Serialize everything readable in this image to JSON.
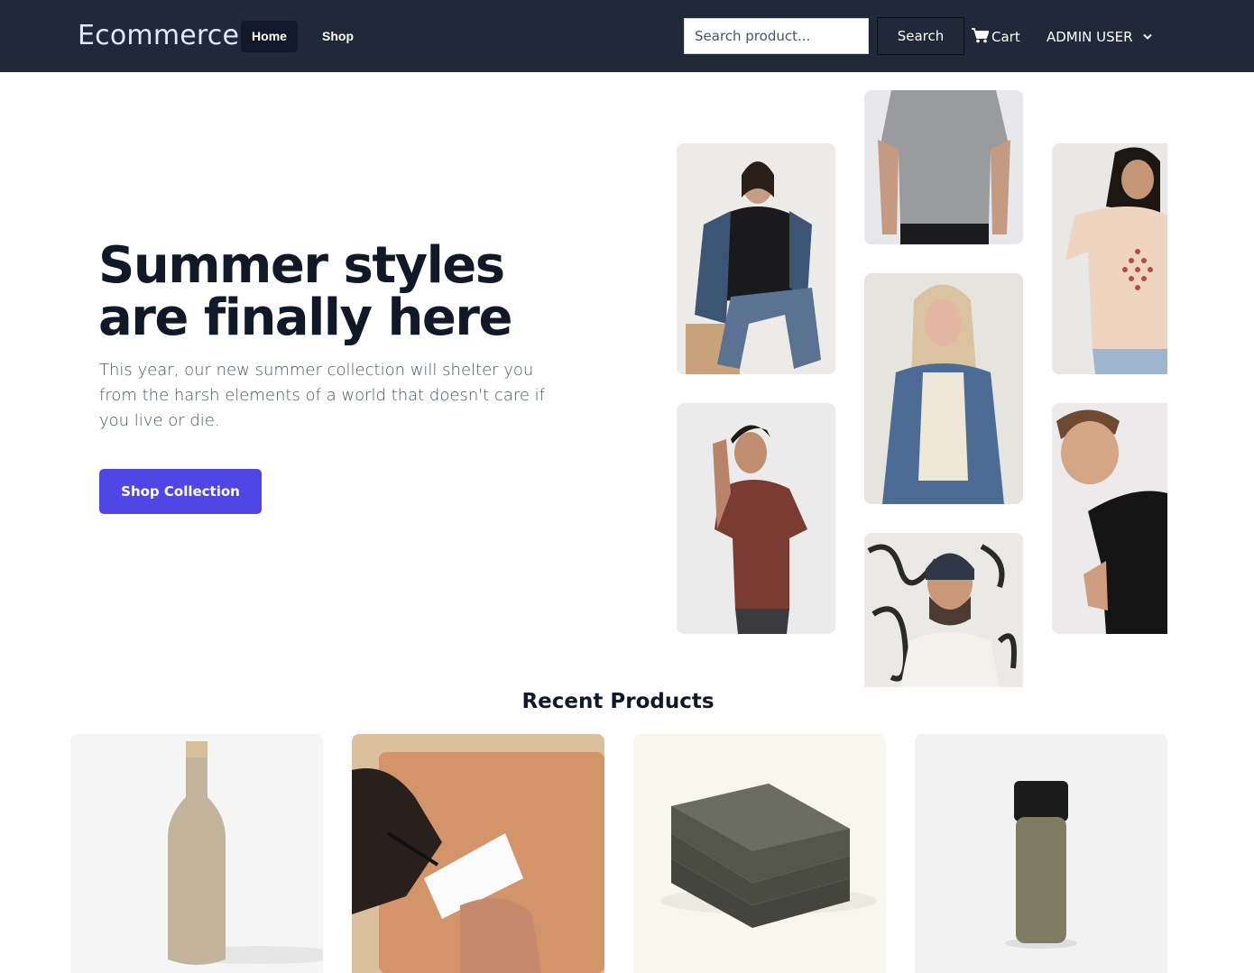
{
  "navbar": {
    "brand": "Ecommerce",
    "links": [
      {
        "label": "Home",
        "active": true
      },
      {
        "label": "Shop",
        "active": false
      }
    ],
    "search": {
      "placeholder": "Search product...",
      "value": "",
      "button_label": "Search"
    },
    "cart_label": "Cart",
    "cart_icon": "shopping-cart-icon",
    "user_label": "ADMIN USER",
    "user_icon": "chevron-down-icon"
  },
  "hero": {
    "title_line1": "Summer styles",
    "title_line2": "are finally here",
    "description": "This year, our new summer collection will shelter you from the harsh elements of a world that doesn't care if you live or die.",
    "cta_label": "Shop Collection",
    "accent_color": "#4f46e5"
  },
  "recent": {
    "title": "Recent Products"
  },
  "colors": {
    "navbar_bg": "#1f2937",
    "brand_text": "#e0e7ff",
    "heading": "#111827",
    "body_text": "#4b5563",
    "accent": "#4f46e5"
  }
}
